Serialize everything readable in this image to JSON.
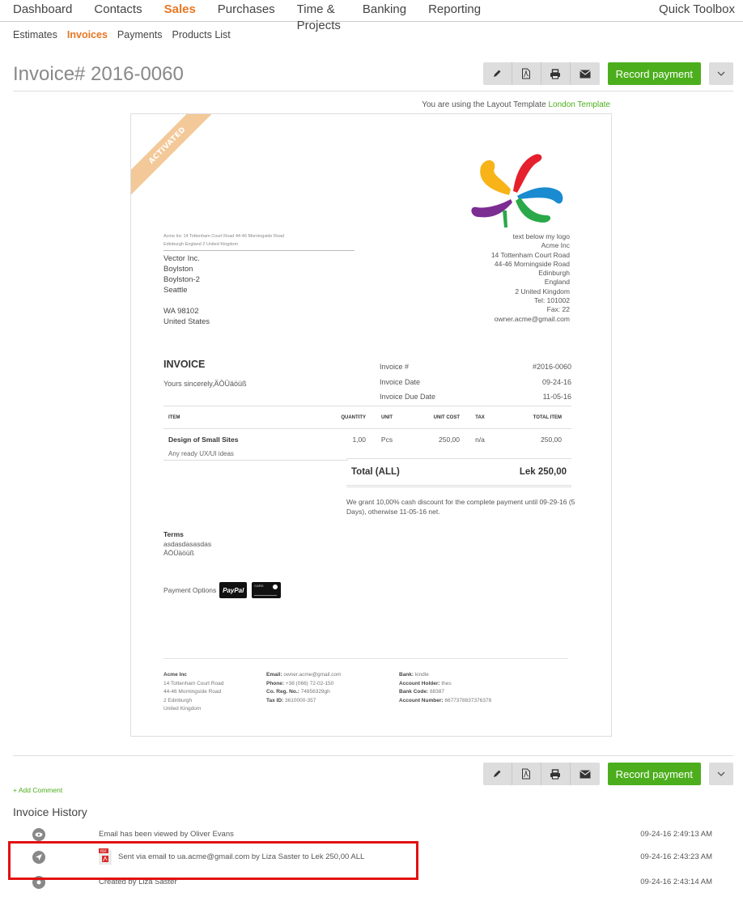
{
  "topnav": {
    "items": [
      {
        "label": "Dashboard",
        "active": false
      },
      {
        "label": "Contacts",
        "active": false
      },
      {
        "label": "Sales",
        "active": true
      },
      {
        "label": "Purchases",
        "active": false
      },
      {
        "label": "Time & Projects",
        "active": false
      },
      {
        "label": "Banking",
        "active": false
      },
      {
        "label": "Reporting",
        "active": false
      }
    ],
    "quick_toolbox": "Quick Toolbox"
  },
  "subnav": {
    "items": [
      {
        "label": "Estimates",
        "active": false
      },
      {
        "label": "Invoices",
        "active": true
      },
      {
        "label": "Payments",
        "active": false
      },
      {
        "label": "Products List",
        "active": false
      }
    ]
  },
  "page_title": "Invoice# 2016-0060",
  "actions": {
    "edit_icon": "pencil-icon",
    "pdf_icon": "pdf-icon",
    "print_icon": "print-icon",
    "email_icon": "envelope-icon",
    "record_payment": "Record payment",
    "more_icon": "chevron-down-icon"
  },
  "template_note": {
    "prefix": "You are using the Layout Template ",
    "link": "London Template"
  },
  "invoice": {
    "status_ribbon": "ACTIVATED",
    "sender_line_1": "Acme Inc 14 Tottenham Court Road 44-46 Morningside Road",
    "sender_line_2": "Edinburgh England 2 United Kingdom",
    "recipient": [
      "Vector Inc.",
      "Boylston",
      "Boylston-2",
      "Seattle",
      "",
      "WA 98102",
      "United States"
    ],
    "company": [
      "text below my logo",
      "Acme Inc",
      "14 Tottenham Court Road",
      "44-46 Morningside Road",
      "Edinburgh",
      "England",
      "2 United Kingdom",
      "Tel: 101002",
      "Fax: 22",
      "owner.acme@gmail.com"
    ],
    "heading": "INVOICE",
    "greeting": "Yours sincerely,ÄÖÜäöüß",
    "meta": [
      {
        "label": "Invoice #",
        "value": "#2016-0060"
      },
      {
        "label": "Invoice Date",
        "value": "09-24-16"
      },
      {
        "label": "Invoice Due Date",
        "value": "11-05-16"
      }
    ],
    "columns": [
      "ITEM",
      "QUANTITY",
      "UNIT",
      "UNIT COST",
      "TAX",
      "TOTAL ITEM"
    ],
    "line_items": [
      {
        "item": "Design of Small Sites",
        "quantity": "1,00",
        "unit": "Pcs",
        "unit_cost": "250,00",
        "tax": "n/a",
        "total": "250,00",
        "description": "Any ready UX/UI ideas"
      }
    ],
    "total_label": "Total (ALL)",
    "total_value": "Lek 250,00",
    "discount_text": "We grant 10,00% cash discount for the complete payment until 09-29-16 (5 Days), otherwise 11-05-16 net.",
    "terms_title": "Terms",
    "terms_lines": [
      "asdasdasasdas",
      "ÄÖÜäöüß"
    ],
    "payment_options_label": "Payment Options",
    "payment_methods": [
      "PayPal",
      "CARD"
    ],
    "footer": {
      "col1": [
        "Acme Inc",
        "14 Tottenham Court Road",
        "44-46 Morningside Road",
        "2 Edinburgh",
        "United Kingdom"
      ],
      "col2": [
        {
          "label": "Email:",
          "value": "owner.acme@gmail.com"
        },
        {
          "label": "Phone:",
          "value": "+38 (066) 72-02-150"
        },
        {
          "label": "Co. Reg. No.:",
          "value": "74856329gh"
        },
        {
          "label": "Tax ID:",
          "value": "3610000-357"
        }
      ],
      "col3": [
        {
          "label": "Bank:",
          "value": "kindle"
        },
        {
          "label": "Account Holder:",
          "value": "thes"
        },
        {
          "label": "Bank Code:",
          "value": "88387"
        },
        {
          "label": "Account Number:",
          "value": "6677378837376378"
        }
      ]
    }
  },
  "add_comment": "+ Add Comment",
  "history": {
    "title": "Invoice History",
    "entries": [
      {
        "icon": "eye-icon",
        "text": "Email has been viewed by Oliver Evans",
        "time": "09-24-16 2:49:13 AM"
      },
      {
        "icon": "send-icon",
        "attachment": "PDF",
        "text": "Sent via email to ua.acme@gmail.com by Liza Saster to Lek 250,00 ALL",
        "time": "09-24-16 2:43:23 AM"
      },
      {
        "icon": "created-icon",
        "text": "Created by Liza Saster",
        "time": "09-24-16 2:43:14 AM"
      }
    ]
  },
  "colors": {
    "accent_orange": "#e87722",
    "primary_green": "#4cae1c",
    "ribbon": "#f3c999",
    "highlight_red": "#e31010"
  }
}
